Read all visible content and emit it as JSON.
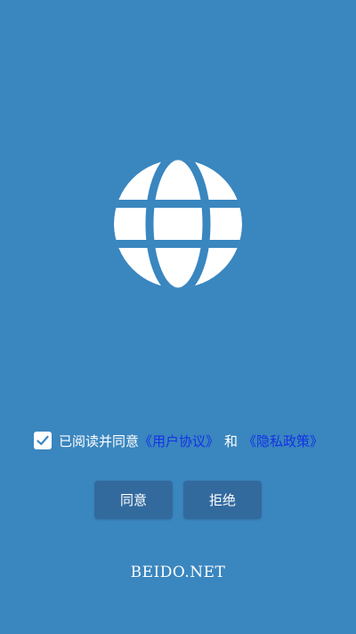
{
  "consent": {
    "checked": true,
    "prefix": "已阅读并同意",
    "user_agreement": "《用户协议》",
    "conjunction": "和",
    "privacy_policy": "《隐私政策》"
  },
  "buttons": {
    "agree": "同意",
    "reject": "拒绝"
  },
  "footer": {
    "brand": "BEIDO.NET"
  },
  "icons": {
    "logo": "globe-icon",
    "checkbox": "checkmark-icon"
  },
  "colors": {
    "background": "#3a86bf",
    "link": "#1232e6",
    "button": "#336a9e"
  }
}
